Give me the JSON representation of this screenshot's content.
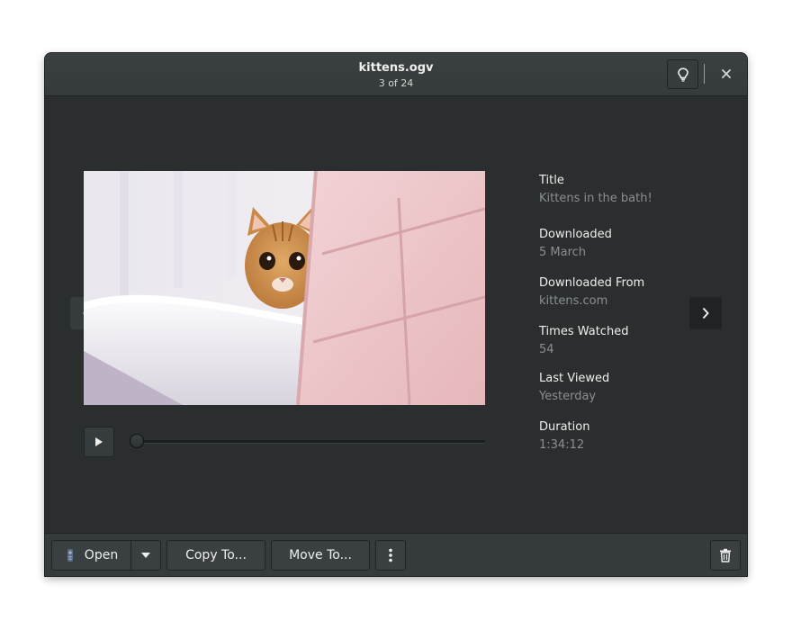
{
  "window": {
    "title": "kittens.ogv",
    "subtitle": "3 of 24",
    "icons": {
      "tips": "lightbulb-icon",
      "close": "close-icon"
    }
  },
  "viewer": {
    "prev_icon": "chevron-left-icon",
    "next_icon": "chevron-right-icon",
    "media_description": "Video frame: orange tabby kitten peeking from behind a white bathtub edge next to pink tiles",
    "player": {
      "play_icon": "play-icon",
      "progress": 0
    }
  },
  "info": [
    {
      "label": "Title",
      "value": "Kittens in the bath!"
    },
    {
      "label": "Downloaded",
      "value": "5 March"
    },
    {
      "label": "Downloaded From",
      "value": "kittens.com"
    },
    {
      "label": "Times Watched",
      "value": "54"
    },
    {
      "label": "Last Viewed",
      "value": "Yesterday"
    },
    {
      "label": "Duration",
      "value": "1:34:12"
    }
  ],
  "actions": {
    "open_label": "Open",
    "copy_label": "Copy To...",
    "move_label": "Move To...",
    "more_icon": "more-vertical-icon",
    "delete_icon": "trash-icon",
    "dropdown_icon": "caret-down-icon"
  }
}
